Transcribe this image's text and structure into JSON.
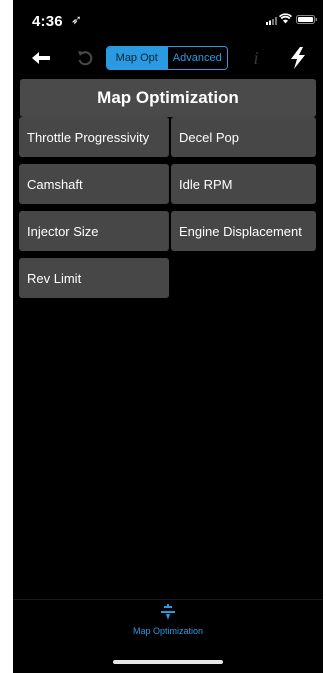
{
  "status_bar": {
    "time": "4:36",
    "location_glyph": "➶"
  },
  "toolbar": {
    "segments": [
      {
        "label": "Map Opt",
        "selected": true
      },
      {
        "label": "Advanced",
        "selected": false
      }
    ],
    "info_glyph": "i"
  },
  "header": {
    "title": "Map Optimization"
  },
  "options": [
    "Throttle Progressivity",
    "Decel Pop",
    "Camshaft",
    "Idle RPM",
    "Injector Size",
    "Engine Displacement",
    "Rev Limit"
  ],
  "tabbar": {
    "label": "Map Optimization",
    "icon": "tuning-sliders-icon"
  },
  "colors": {
    "accent": "#2a9be0",
    "tile": "#474747",
    "header": "#4a4a4a",
    "background": "#000000"
  }
}
